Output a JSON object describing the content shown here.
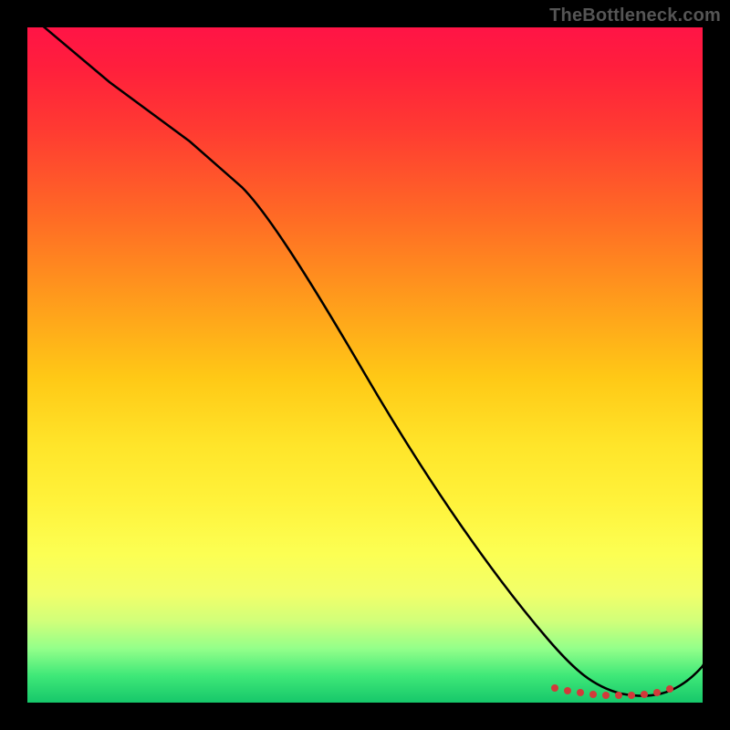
{
  "watermark": "TheBottleneck.com",
  "chart_data": {
    "type": "line",
    "title": "",
    "xlabel": "",
    "ylabel": "",
    "xlim": [
      0,
      100
    ],
    "ylim": [
      0,
      100
    ],
    "series": [
      {
        "name": "curve",
        "x": [
          0,
          12,
          24,
          38,
          52,
          66,
          78,
          84,
          90,
          96,
          100
        ],
        "y": [
          103,
          93,
          83,
          66,
          46,
          26,
          8,
          2,
          1,
          2,
          8
        ]
      }
    ],
    "markers": {
      "name": "highlight-range",
      "x": [
        78,
        80,
        82,
        84,
        86,
        88,
        90,
        92,
        94,
        96
      ],
      "y": [
        2.2,
        1.8,
        1.5,
        1.3,
        1.1,
        1.0,
        1.0,
        1.1,
        1.4,
        1.9
      ]
    },
    "gradient_stops": [
      {
        "pos": 0,
        "color": "#ff1446"
      },
      {
        "pos": 50,
        "color": "#ffc916"
      },
      {
        "pos": 80,
        "color": "#fcff53"
      },
      {
        "pos": 100,
        "color": "#16c76a"
      }
    ]
  }
}
